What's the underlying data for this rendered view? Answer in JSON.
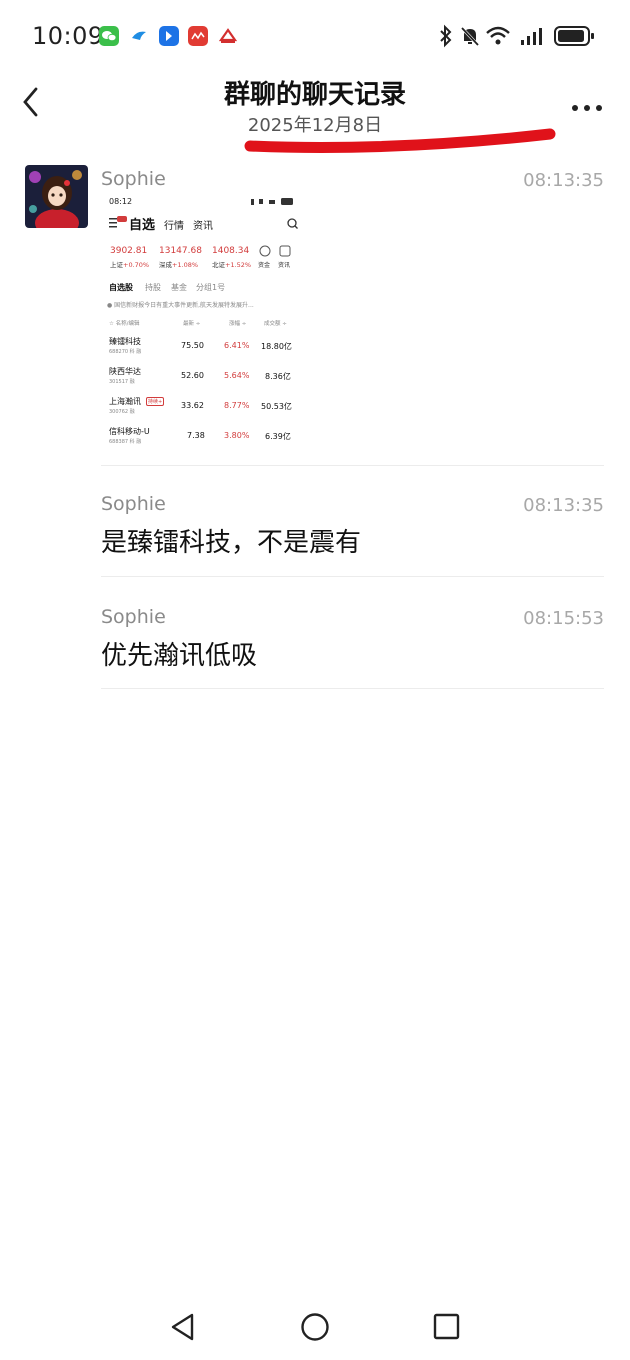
{
  "status_bar": {
    "time": "10:09",
    "apps": [
      {
        "name": "wechat",
        "color": "#3bbf4a"
      },
      {
        "name": "bird-app",
        "color": "#1f8de3"
      },
      {
        "name": "blue-app",
        "color": "#1d73e6"
      },
      {
        "name": "red-app",
        "color": "#e13b33"
      },
      {
        "name": "brand-app",
        "color": "#d32f2f"
      }
    ]
  },
  "header": {
    "title": "群聊的聊天记录",
    "date": "2025年12月8日"
  },
  "messages": [
    {
      "sender": "Sophie",
      "time": "08:13:35",
      "type": "image",
      "image": {
        "status_time": "08:12",
        "tab_active": "自选",
        "tabs": [
          "行情",
          "资讯"
        ],
        "indices": [
          {
            "value": "3902.81",
            "name": "上证",
            "change": "+0.70%"
          },
          {
            "value": "13147.68",
            "name": "深成",
            "change": "+1.08%"
          },
          {
            "value": "1408.34",
            "name": "北证",
            "change": "+1.52%"
          }
        ],
        "quick_icons": [
          "资金",
          "资讯"
        ],
        "sub_tabs": [
          "自选股",
          "持股",
          "基金",
          "分组1号"
        ],
        "notice": "● 国信新财报今日有重大事件更新,航天发展特发展升...",
        "columns": [
          "☆ 名称/编辑",
          "最新 ÷",
          "涨幅 ÷",
          "成交额 ÷"
        ],
        "rows": [
          {
            "name": "臻镭科技",
            "code": "688270 科 融",
            "price": "75.50",
            "change": "6.41%",
            "amount": "18.80亿"
          },
          {
            "name": "陕西华达",
            "code": "301517 融",
            "price": "52.60",
            "change": "5.64%",
            "amount": "8.36亿"
          },
          {
            "name": "上海瀚讯",
            "code": "300762 融",
            "tag": "持续+",
            "price": "33.62",
            "change": "8.77%",
            "amount": "50.53亿"
          },
          {
            "name": "信科移动-U",
            "code": "688387 科 融",
            "price": "7.38",
            "change": "3.80%",
            "amount": "6.39亿"
          }
        ]
      }
    },
    {
      "sender": "Sophie",
      "time": "08:13:35",
      "type": "text",
      "text": "是臻镭科技，不是震有"
    },
    {
      "sender": "Sophie",
      "time": "08:15:53",
      "type": "text",
      "text": "优先瀚讯低吸"
    }
  ]
}
